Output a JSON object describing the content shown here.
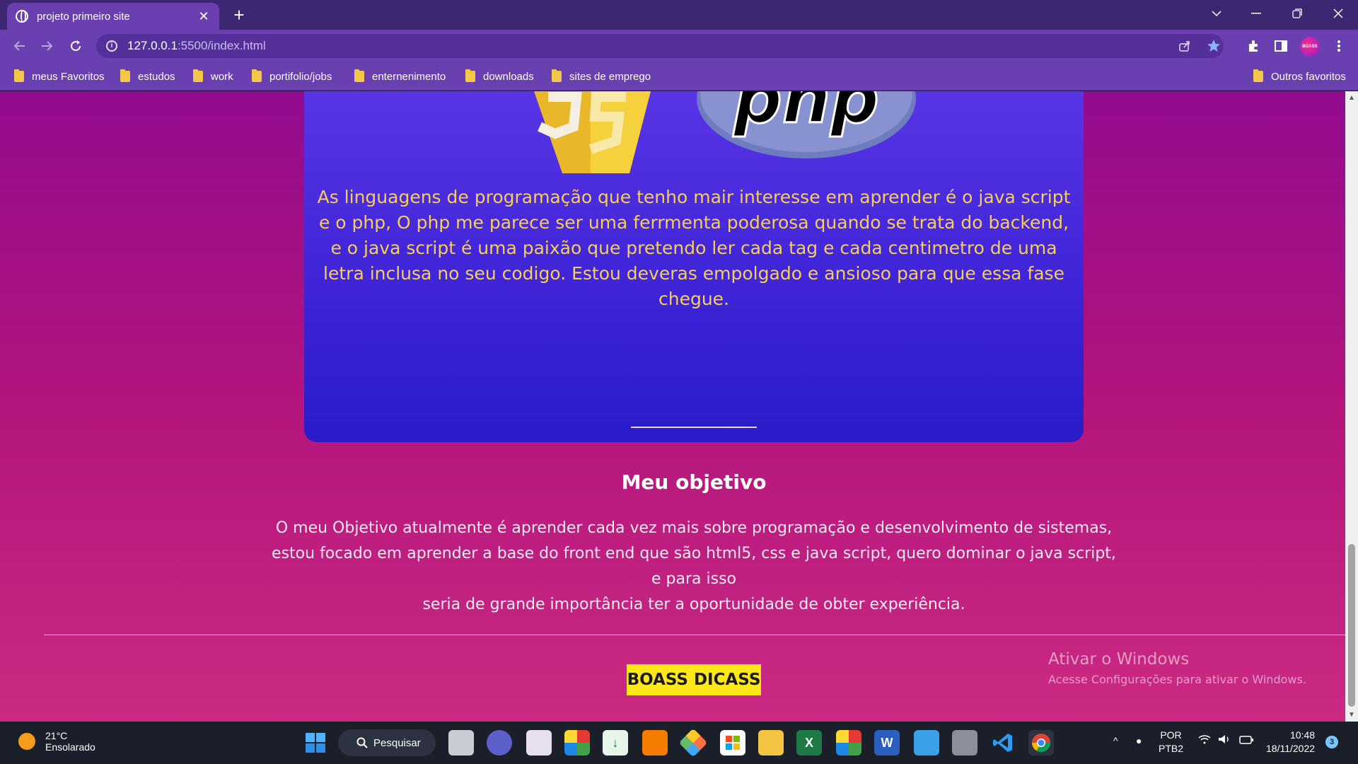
{
  "browser": {
    "tab_title": "projeto primeiro site",
    "tab_close": "✕",
    "new_tab": "+",
    "url_host": "127.0.0.1",
    "url_path": ":5500/index.html",
    "avatar_text": "BOASS",
    "bookmarks": [
      "meus Favoritos",
      "estudos",
      "work",
      "portifolio/jobs",
      "enternenimento",
      "downloads",
      "sites de emprego"
    ],
    "other_bookmarks": "Outros favoritos"
  },
  "page": {
    "card_text": "As linguagens de programação que tenho mair interesse em aprender é o java script e o php, O php me parece ser uma ferrmenta poderosa quando se trata do backend, e o java script é uma paixão que pretendo ler cada tag e cada centimetro de uma letra inclusa no seu codigo. Estou deveras empolgado e ansioso para que essa fase chegue.",
    "php_logo_text": "php",
    "objective_title": "Meu objetivo",
    "objective_lines": [
      "O meu Objetivo atualmente é aprender cada vez mais sobre programação e desenvolvimento de sistemas,",
      "estou focado em aprender a base do front end que são html5, css e java script, quero dominar o java script, e para isso",
      "seria de grande importância ter a oportunidade de obter experiência."
    ],
    "brand": "BOASS DICASS"
  },
  "watermark": {
    "title": "Ativar o Windows",
    "subtitle": "Acesse Configurações para ativar o Windows."
  },
  "taskbar": {
    "temperature": "21°C",
    "weather": "Ensolarado",
    "search_label": "Pesquisar",
    "lang_line1": "POR",
    "lang_line2": "PTB2",
    "time": "10:48",
    "date": "18/11/2022",
    "notification_count": "3"
  }
}
